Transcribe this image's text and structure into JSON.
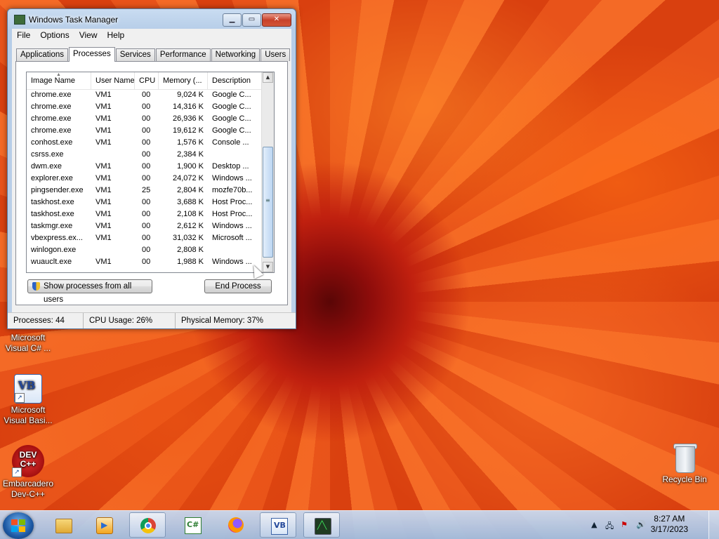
{
  "window": {
    "title": "Windows Task Manager",
    "menu": [
      "File",
      "Options",
      "View",
      "Help"
    ],
    "tabs": [
      "Applications",
      "Processes",
      "Services",
      "Performance",
      "Networking",
      "Users"
    ],
    "active_tab": "Processes",
    "columns": [
      "Image Name",
      "User Name",
      "CPU",
      "Memory (...",
      "Description"
    ],
    "processes": [
      {
        "name": "chrome.exe",
        "user": "VM1",
        "cpu": "00",
        "mem": "9,024 K",
        "desc": "Google C..."
      },
      {
        "name": "chrome.exe",
        "user": "VM1",
        "cpu": "00",
        "mem": "14,316 K",
        "desc": "Google C..."
      },
      {
        "name": "chrome.exe",
        "user": "VM1",
        "cpu": "00",
        "mem": "26,936 K",
        "desc": "Google C..."
      },
      {
        "name": "chrome.exe",
        "user": "VM1",
        "cpu": "00",
        "mem": "19,612 K",
        "desc": "Google C..."
      },
      {
        "name": "conhost.exe",
        "user": "VM1",
        "cpu": "00",
        "mem": "1,576 K",
        "desc": "Console ..."
      },
      {
        "name": "csrss.exe",
        "user": "",
        "cpu": "00",
        "mem": "2,384 K",
        "desc": ""
      },
      {
        "name": "dwm.exe",
        "user": "VM1",
        "cpu": "00",
        "mem": "1,900 K",
        "desc": "Desktop ..."
      },
      {
        "name": "explorer.exe",
        "user": "VM1",
        "cpu": "00",
        "mem": "24,072 K",
        "desc": "Windows ..."
      },
      {
        "name": "pingsender.exe",
        "user": "VM1",
        "cpu": "25",
        "mem": "2,804 K",
        "desc": "mozfe70b..."
      },
      {
        "name": "taskhost.exe",
        "user": "VM1",
        "cpu": "00",
        "mem": "3,688 K",
        "desc": "Host Proc..."
      },
      {
        "name": "taskhost.exe",
        "user": "VM1",
        "cpu": "00",
        "mem": "2,108 K",
        "desc": "Host Proc..."
      },
      {
        "name": "taskmgr.exe",
        "user": "VM1",
        "cpu": "00",
        "mem": "2,612 K",
        "desc": "Windows ..."
      },
      {
        "name": "vbexpress.ex...",
        "user": "VM1",
        "cpu": "00",
        "mem": "31,032 K",
        "desc": "Microsoft ..."
      },
      {
        "name": "winlogon.exe",
        "user": "",
        "cpu": "00",
        "mem": "2,808 K",
        "desc": ""
      },
      {
        "name": "wuauclt.exe",
        "user": "VM1",
        "cpu": "00",
        "mem": "1,988 K",
        "desc": "Windows ..."
      }
    ],
    "show_all_button": "Show processes from all users",
    "end_process_button": "End Process",
    "status": {
      "processes": "Processes: 44",
      "cpu": "CPU Usage: 26%",
      "memory": "Physical Memory: 37%"
    }
  },
  "desktop": {
    "icons": [
      {
        "label": "Microsoft Visual C# ...",
        "icon": "visual-csharp-icon"
      },
      {
        "label": "Microsoft Visual Basi...",
        "icon": "visual-basic-icon"
      },
      {
        "label": "Embarcadero Dev-C++",
        "icon": "devcpp-icon"
      },
      {
        "label": "Recycle Bin",
        "icon": "recycle-bin-icon"
      }
    ],
    "devcpp_glyph": "DEV C++",
    "vb_glyph": "VB"
  },
  "taskbar": {
    "apps": [
      "explorer",
      "media-player",
      "chrome",
      "visual-csharp",
      "firefox",
      "visual-basic",
      "task-manager"
    ],
    "active_app": "task-manager",
    "time": "8:27 AM",
    "date": "3/17/2023"
  },
  "colors": {
    "accent": "#3d7cc9",
    "wallpaper": "#e4521b"
  }
}
